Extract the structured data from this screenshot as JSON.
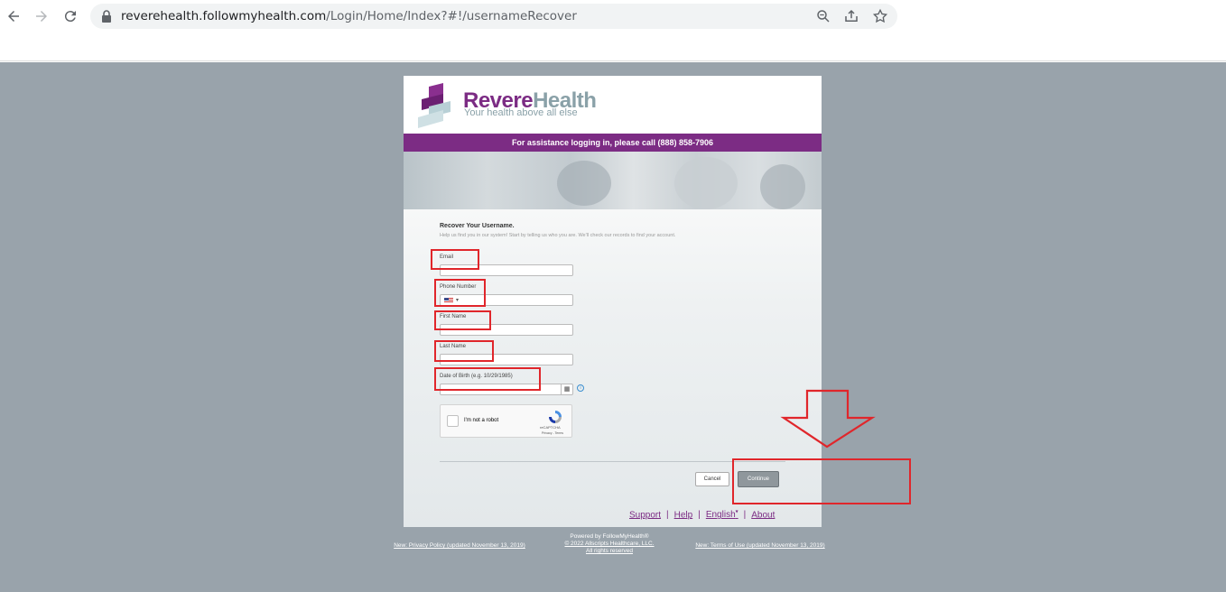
{
  "browser": {
    "url_host": "reverehealth.followmyhealth.com",
    "url_path": "/Login/Home/Index?#!/usernameRecover"
  },
  "brand": {
    "name_a": "Revere",
    "name_b": "Health",
    "tagline": "Your health above all else"
  },
  "assist_bar": "For assistance logging in, please call (888) 858-7906",
  "form": {
    "title": "Recover Your Username.",
    "subtitle": "Help us find you in our system! Start by telling us who you are. We'll check our records to find your account.",
    "email_label": "Email",
    "phone_label": "Phone Number",
    "first_name_label": "First Name",
    "last_name_label": "Last Name",
    "dob_label": "Date of Birth (e.g. 10/29/1985)",
    "recaptcha_label": "I'm not a robot",
    "recaptcha_brand": "reCAPTCHA",
    "recaptcha_terms": "Privacy - Terms",
    "cancel_label": "Cancel",
    "continue_label": "Continue"
  },
  "footer": {
    "support": "Support",
    "help": "Help",
    "english": "English",
    "about": "About",
    "sep": "|"
  },
  "below": {
    "privacy": "New: Privacy Policy (updated November 13, 2019)",
    "powered": "Powered by FollowMyHealth®",
    "copyright": "© 2022 Allscripts Healthcare, LLC.",
    "rights": "All rights reserved",
    "terms": "New: Terms of Use (updated November 13, 2019)"
  },
  "colors": {
    "brand_purple": "#7c2c84",
    "page_bg": "#99a3ab",
    "annotation_red": "#e0262b"
  }
}
